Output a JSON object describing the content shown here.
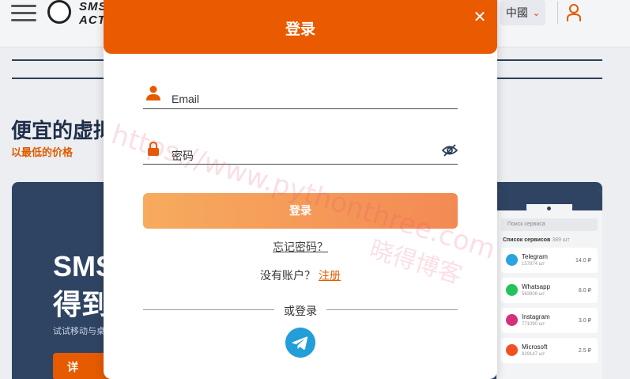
{
  "header": {
    "logo_line1": "SMS",
    "logo_line2": "ACT",
    "language": "中國"
  },
  "hero": {
    "title": "便宜的虚拟",
    "subtitle": "以最低的价格"
  },
  "banner": {
    "big_line1": "SMS",
    "big_line2": "得到",
    "small_text": "试试移动与桌",
    "button_label": "详"
  },
  "phone": {
    "search_placeholder": "Поиск сервиса",
    "list_title": "Список сервисов",
    "list_count": "389 шт",
    "items": [
      {
        "name": "Telegram",
        "count": "157874 шт",
        "price": "14.0 ₽",
        "color": "#2aa3df"
      },
      {
        "name": "Whatsapp",
        "count": "563908 шт",
        "price": "8.0 ₽",
        "color": "#25c25a"
      },
      {
        "name": "Instagram",
        "count": "771090 шт",
        "price": "3.0 ₽",
        "color": "#d6307c"
      },
      {
        "name": "Microsoft",
        "count": "829147 шт",
        "price": "2.5 ₽",
        "color": "#f25022"
      }
    ]
  },
  "modal": {
    "title": "登录",
    "close_symbol": "✕",
    "email_placeholder": "Email",
    "password_placeholder": "密码",
    "login_button": "登录",
    "forgot_password": "忘记密码？",
    "no_account": "没有账户？",
    "register": "注册",
    "or_login": "或登录"
  },
  "watermark": {
    "url": "https://www.pythonthree.com",
    "name": "晓得博客"
  },
  "colors": {
    "accent": "#ea5a00",
    "button_gradient_start": "#f7ab5e",
    "button_gradient_end": "#f38a54",
    "navy": "#2f4463"
  }
}
